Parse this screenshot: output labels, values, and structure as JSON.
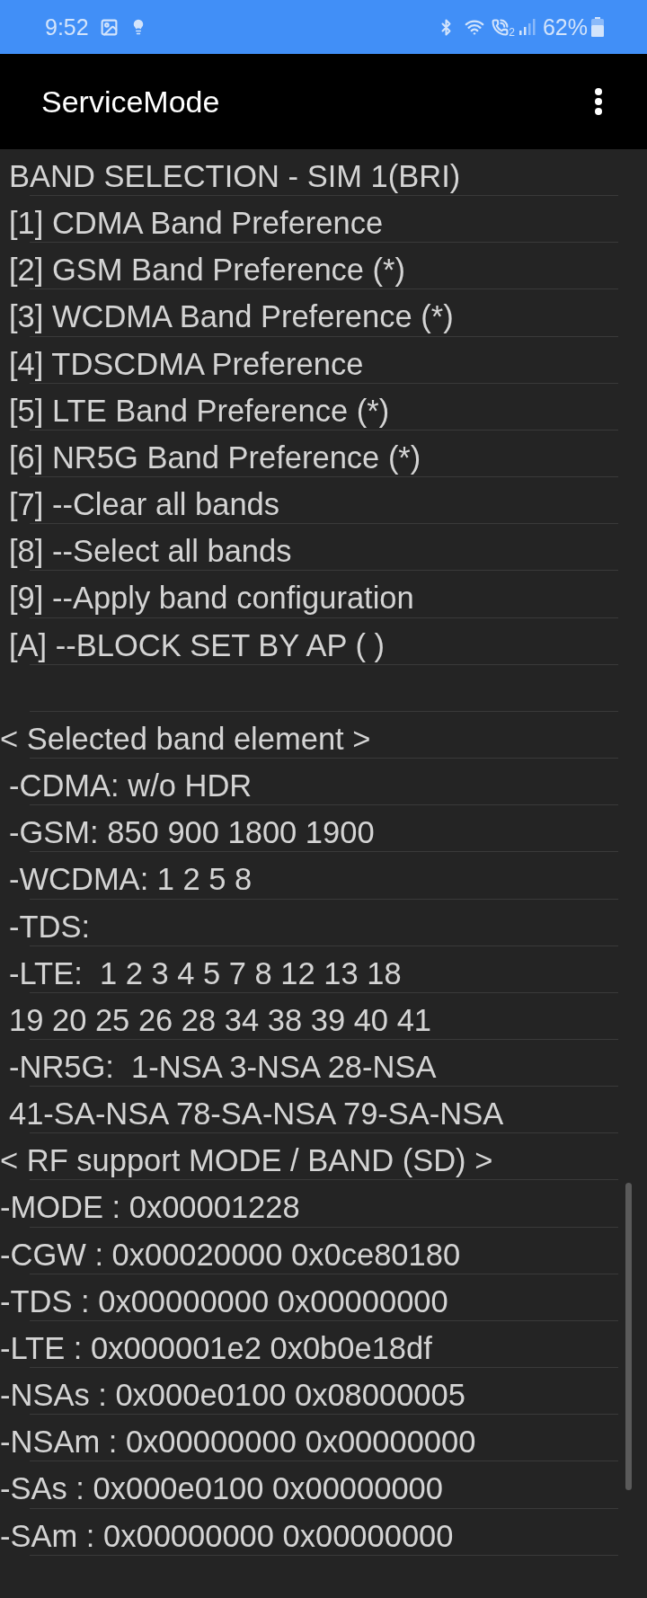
{
  "status_bar": {
    "time": "9:52",
    "call_sim": "2",
    "battery": "62%"
  },
  "app_bar": {
    "title": "ServiceMode"
  },
  "menu": {
    "heading": "BAND SELECTION - SIM 1(BRI)",
    "options": [
      "[1] CDMA Band Preference",
      "[2] GSM Band Preference (*)",
      "[3] WCDMA Band Preference (*)",
      "[4] TDSCDMA Preference",
      "[5] LTE Band Preference (*)",
      "[6] NR5G Band Preference (*)",
      "[7] --Clear all bands",
      "[8] --Select all bands",
      "[9] --Apply band configuration",
      "[A] --BLOCK SET BY AP ( )"
    ]
  },
  "selected_band_element": {
    "heading": "< Selected band element >",
    "lines": [
      "-CDMA: w/o HDR",
      "-GSM: 850 900 1800 1900",
      "-WCDMA: 1 2 5 8",
      "-TDS:",
      "-LTE:  1 2 3 4 5 7 8 12 13 18",
      "19 20 25 26 28 34 38 39 40 41",
      "-NR5G:  1-NSA 3-NSA 28-NSA",
      "41-SA-NSA 78-SA-NSA 79-SA-NSA"
    ]
  },
  "rf_support": {
    "heading": "< RF support MODE / BAND (SD) >",
    "lines": [
      "-MODE : 0x00001228",
      "-CGW : 0x00020000 0x0ce80180",
      "-TDS : 0x00000000 0x00000000",
      "-LTE : 0x000001e2 0x0b0e18df",
      "-NSAs : 0x000e0100 0x08000005",
      "-NSAm : 0x00000000 0x00000000",
      "-SAs : 0x000e0100 0x00000000",
      "-SAm : 0x00000000 0x00000000"
    ]
  }
}
